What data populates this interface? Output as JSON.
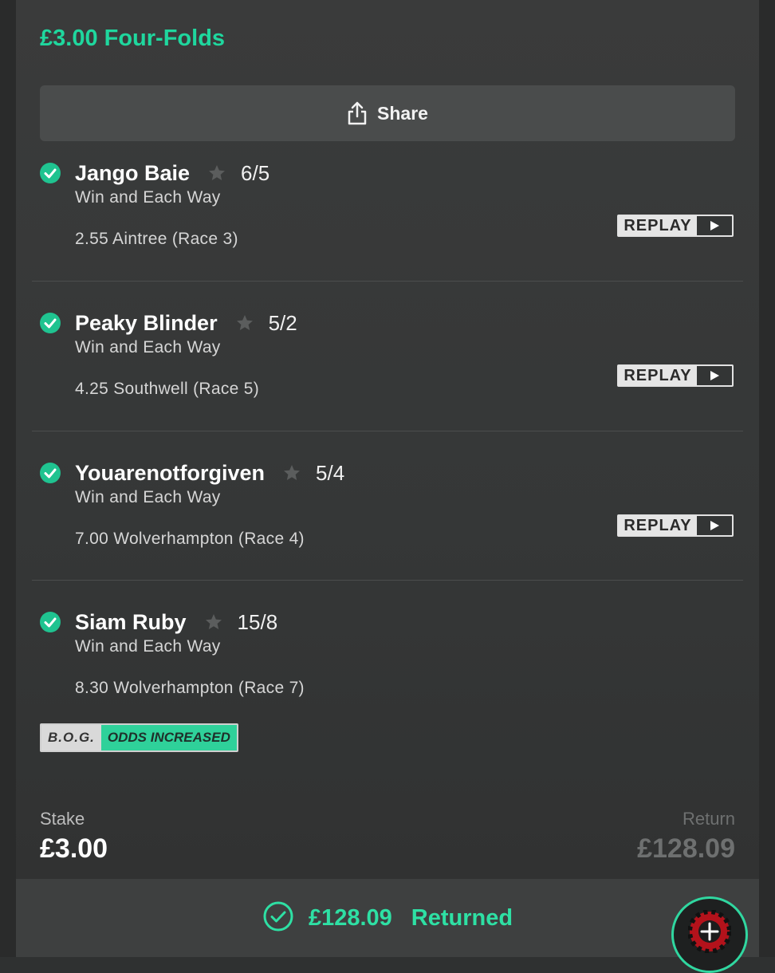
{
  "bet": {
    "title": "£3.00 Four-Folds",
    "share_label": "Share"
  },
  "selections": [
    {
      "name": "Jango Baie",
      "odds": "6/5",
      "market": "Win and Each Way",
      "event": "2.55 Aintree (Race 3)",
      "replay_label": "REPLAY"
    },
    {
      "name": "Peaky Blinder",
      "odds": "5/2",
      "market": "Win and Each Way",
      "event": "4.25 Southwell (Race 5)",
      "replay_label": "REPLAY"
    },
    {
      "name": "Youarenotforgiven",
      "odds": "5/4",
      "market": "Win and Each Way",
      "event": "7.00 Wolverhampton (Race 4)",
      "replay_label": "REPLAY"
    },
    {
      "name": "Siam Ruby",
      "odds": "15/8",
      "market": "Win and Each Way",
      "event": "8.30 Wolverhampton (Race 7)"
    }
  ],
  "badge": {
    "bog": "B.O.G.",
    "odds_increased": "ODDS INCREASED"
  },
  "summary": {
    "stake_label": "Stake",
    "stake_value": "£3.00",
    "return_label": "Return",
    "return_value": "£128.09"
  },
  "footer": {
    "amount": "£128.09",
    "status": "Returned"
  },
  "colors": {
    "accent": "#1fd79e",
    "background": "#353737",
    "muted": "#6e7070"
  },
  "icons": [
    "share-icon",
    "check-circle-icon",
    "star-icon",
    "play-icon",
    "roulette-icon"
  ]
}
